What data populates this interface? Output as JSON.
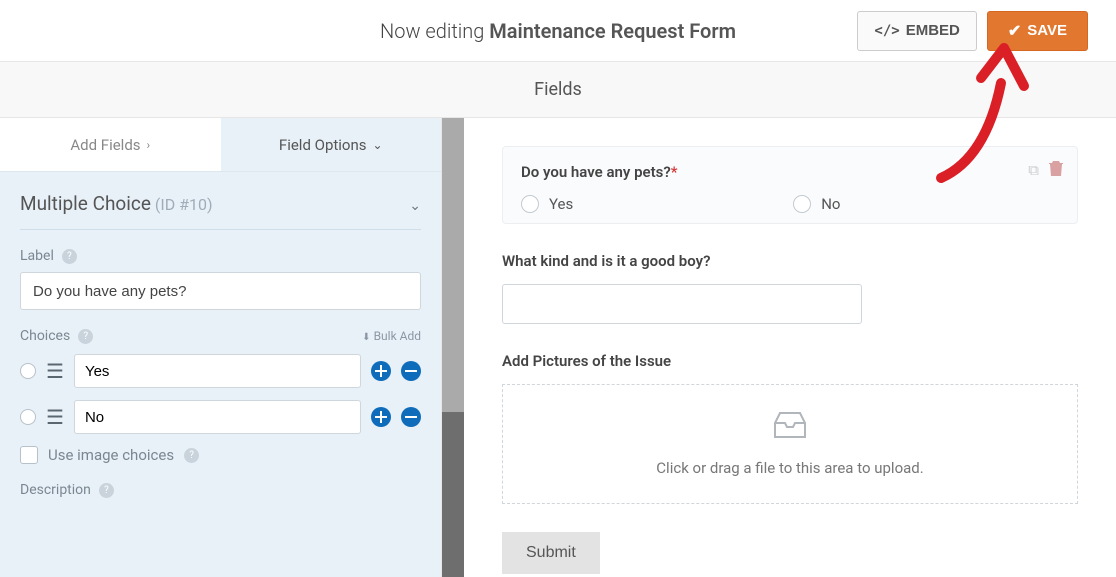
{
  "topbar": {
    "now_editing_prefix": "Now editing ",
    "form_name": "Maintenance Request Form",
    "embed_label": "EMBED",
    "save_label": "SAVE"
  },
  "fields_header": "Fields",
  "tabs": {
    "add_fields": "Add Fields",
    "field_options": "Field Options"
  },
  "options": {
    "field_type": "Multiple Choice",
    "field_id": "(ID #10)",
    "label_heading": "Label",
    "label_value": "Do you have any pets?",
    "choices_heading": "Choices",
    "bulk_add": "Bulk Add",
    "choices": [
      "Yes",
      "No"
    ],
    "use_image_choices": "Use image choices",
    "description_heading": "Description"
  },
  "preview": {
    "pets_label": "Do you have any pets?",
    "pets_options": [
      "Yes",
      "No"
    ],
    "kind_label": "What kind and is it a good boy?",
    "pictures_label": "Add Pictures of the Issue",
    "upload_hint": "Click or drag a file to this area to upload.",
    "submit_label": "Submit"
  }
}
